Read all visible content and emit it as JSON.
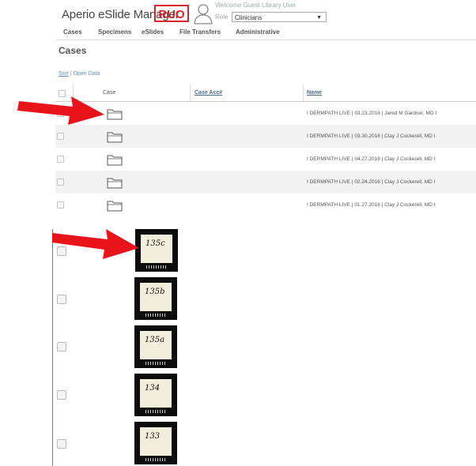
{
  "header": {
    "brand": "Aperio eSlide Manager",
    "badge": "RUO",
    "welcome": "Welcome Guest Library User",
    "role_label": "Role",
    "role_value": "Clinicians"
  },
  "nav": {
    "items": [
      "Cases",
      "Specimens",
      "eSlides",
      "File Transfers",
      "Administrative"
    ]
  },
  "page": {
    "title": "Cases",
    "sort_label": "Sort",
    "separator": "|",
    "open_data_label": "Open Data"
  },
  "table": {
    "columns": [
      "Case",
      "Case Acc#",
      "Name"
    ],
    "rows": [
      {
        "name": "I DERMPATH LIVE | 03.23.2016 | Jared M Gardner, MD I"
      },
      {
        "name": "I DERMPATH LIVE | 03.30.2016 | Clay J Cockerell, MD I"
      },
      {
        "name": "I DERMPATH LIVE | 04.27.2016 | Clay J Cockerell, MD I"
      },
      {
        "name": "I DERMPATH LIVE | 02.24.2016 | Clay J Cockerell, MD I"
      },
      {
        "name": "I DERMPATH LIVE | 01.27.2016 | Clay J Cockerell, MD I"
      }
    ]
  },
  "slides": {
    "labels": [
      "135c",
      "135b",
      "135a",
      "134",
      "133"
    ]
  },
  "colors": {
    "accent_red": "#e8141a",
    "badge_red": "#d8262b",
    "link_blue": "#5a8fc4"
  }
}
